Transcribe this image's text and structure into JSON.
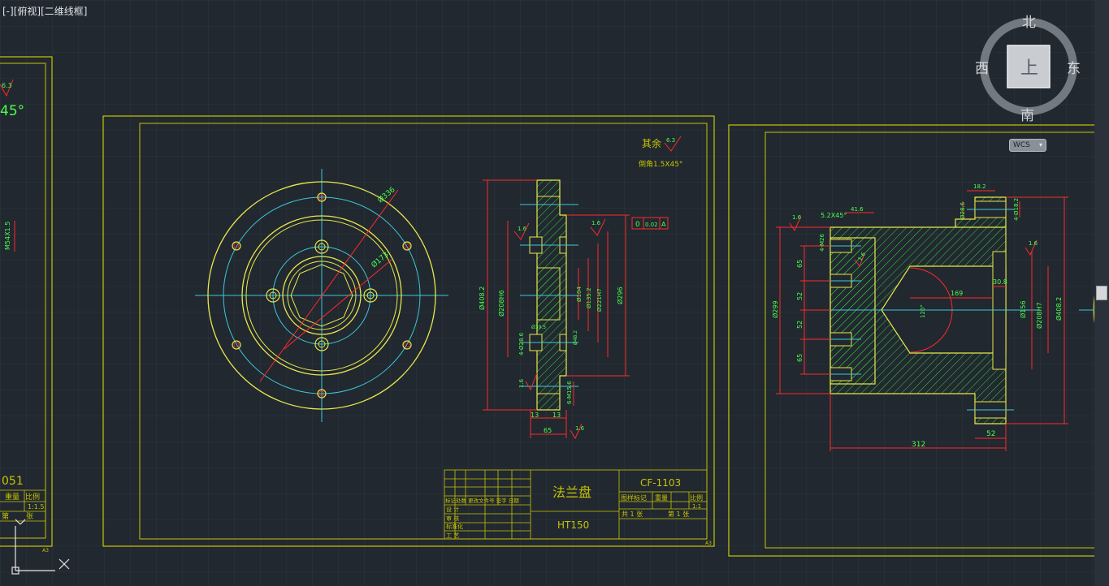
{
  "view_label": {
    "minus": "[-]",
    "view": "[俯视]",
    "style": "[二维线框]"
  },
  "viewcube": {
    "north": "北",
    "south": "南",
    "east": "东",
    "west": "西",
    "top_face": "上",
    "wcs": "WCS"
  },
  "left_sheet": {
    "roughness": "6.3",
    "chamfer": "45°",
    "dim": "M54X1.5",
    "drawing_no_fragment": "051",
    "title_cells": [
      "重量",
      "比例",
      "1:1.5",
      "第",
      "张"
    ],
    "sheet_size": "A3"
  },
  "middle_sheet": {
    "note_other": "其余",
    "note_roughness": "6.3",
    "note_chamfer": "倒角1.5X45°",
    "front_view_dims": [
      "Ø336",
      "Ø173"
    ],
    "section_dims": [
      "1.6",
      "Ø408.2",
      "Ø208H6",
      "Ø104",
      "Ø135.2",
      "Ø221H7",
      "Ø296",
      "4-Ø28.6",
      "Ø48.2",
      "Ø39.5",
      "1.6",
      "6-M15.6",
      "13",
      "13",
      "65",
      "1.6",
      "1.6"
    ],
    "geometric_tolerance": [
      "0",
      "0.02",
      "A"
    ],
    "title_block": {
      "part_name": "法兰盘",
      "material": "HT150",
      "drawing_no": "CF-1103",
      "stage_label": "图样标记",
      "weight_label": "重量",
      "scale_label": "比例",
      "scale_value": "1:1",
      "sheets_total": "共 1 张",
      "sheet_no": "第 1 张",
      "change_header": "标记处数 更改文件号 签字 日期",
      "rows": [
        "设 计",
        "审 核",
        "标准化",
        "工 艺"
      ],
      "sheet_size": "A3"
    }
  },
  "right_sheet": {
    "dims": [
      "1.6",
      "5.2X45°",
      "41.6",
      "18.2",
      "Ø28.6",
      "4-Ø18.2",
      "4-M26",
      "1.6",
      "1.6",
      "65",
      "52",
      "52",
      "65",
      "Ø299",
      "169",
      "120°",
      "30.8",
      "Ø156",
      "Ø208H7",
      "Ø408.2",
      "312",
      "52"
    ]
  },
  "colors": {
    "background": "#212830",
    "grid": "#2b333c",
    "sheet_border": "#c8c400",
    "geometry": "#e8e84a",
    "center_line": "#3fc7d8",
    "dimension": "#ff2a2a",
    "hatch": "#39d039",
    "text": "#4cff4c"
  }
}
